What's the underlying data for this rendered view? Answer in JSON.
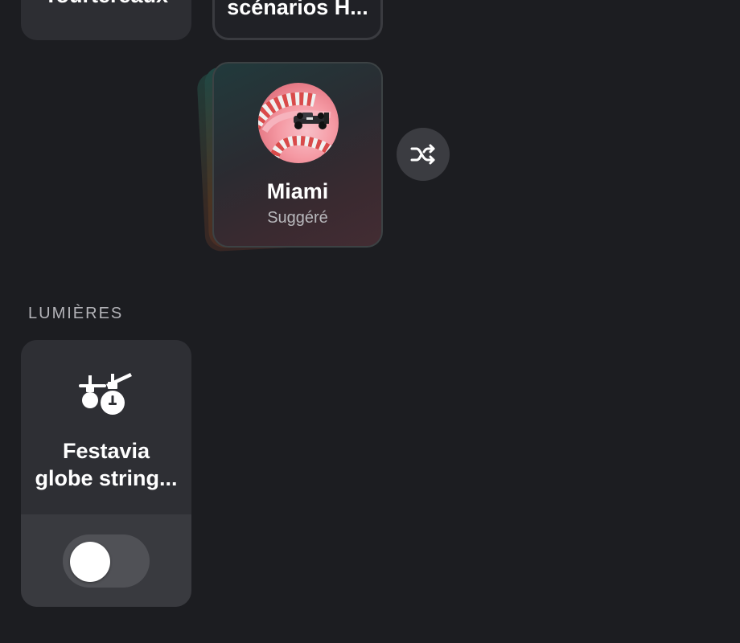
{
  "top_cards": {
    "left_label": "Tourtereaux",
    "mid_label": "scénarios H..."
  },
  "suggested_card": {
    "title": "Miami",
    "subtitle": "Suggéré",
    "image_icon": "race-car-track-image"
  },
  "shuffle_button": {
    "icon": "shuffle-icon"
  },
  "lights_section": {
    "heading": "LUMIÈRES",
    "devices": [
      {
        "name_line1": "Festavia",
        "name_line2": "globe string...",
        "icon": "string-lights-icon",
        "on": false
      }
    ]
  }
}
